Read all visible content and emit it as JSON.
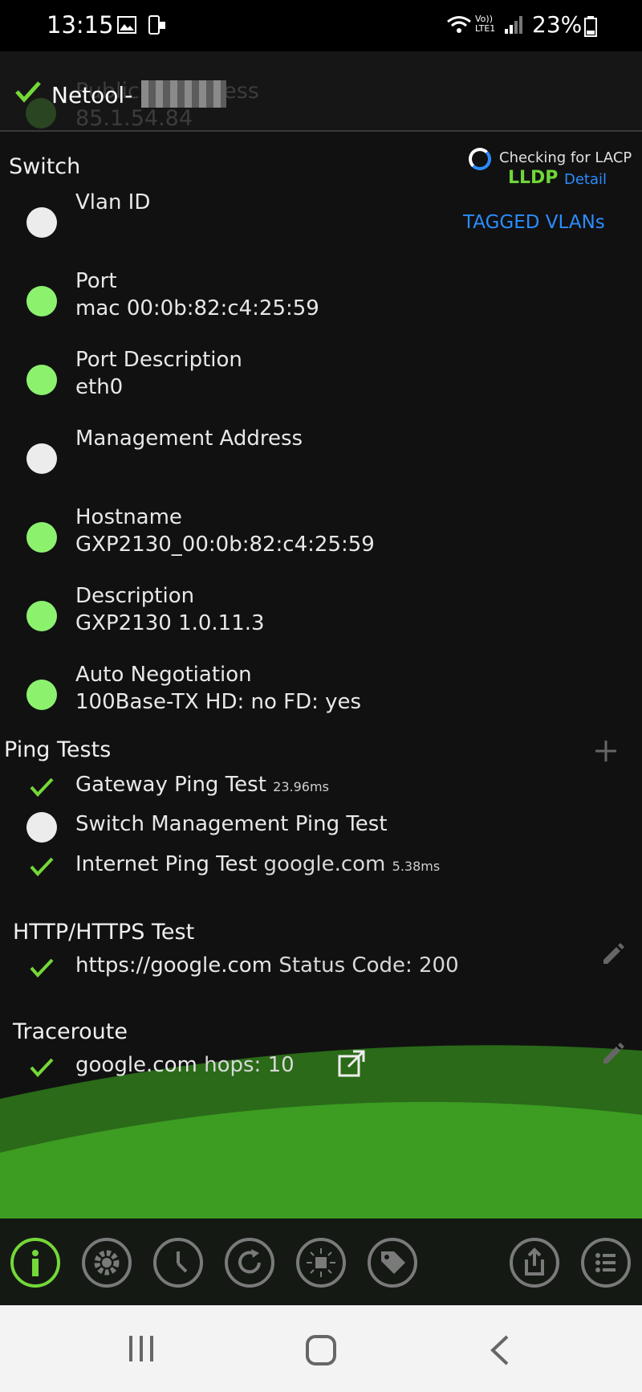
{
  "status_bar": {
    "time": "13:15",
    "battery": "23%",
    "network": "Vo)) LTE1"
  },
  "header": {
    "app_name": "Netool-",
    "faded_label": "Public IP Address",
    "faded_value": "85.1.54.84"
  },
  "switch": {
    "title": "Switch",
    "lacp_status": "Checking for LACP",
    "protocol": "LLDP",
    "detail_link": "Detail",
    "tagged_vlans_button": "TAGGED VLANs",
    "items": [
      {
        "label": "Vlan ID",
        "value": ""
      },
      {
        "label": "Port",
        "value": "mac 00:0b:82:c4:25:59"
      },
      {
        "label": "Port Description",
        "value": "eth0"
      },
      {
        "label": "Management Address",
        "value": ""
      },
      {
        "label": "Hostname",
        "value": "GXP2130_00:0b:82:c4:25:59"
      },
      {
        "label": "Description",
        "value": "GXP2130 1.0.11.3"
      },
      {
        "label": "Auto Negotiation",
        "value": "100Base-TX HD: no FD: yes"
      }
    ]
  },
  "ping_tests": {
    "title": "Ping Tests",
    "items": [
      {
        "label": "Gateway Ping Test",
        "extra": "",
        "time": "23.96ms"
      },
      {
        "label": "Switch Management Ping Test",
        "extra": "",
        "time": ""
      },
      {
        "label": "Internet Ping Test",
        "extra": "google.com",
        "time": "5.38ms"
      }
    ]
  },
  "http_test": {
    "title": "HTTP/HTTPS Test",
    "url": "https://google.com",
    "status": "Status Code: 200"
  },
  "traceroute": {
    "title": "Traceroute",
    "host": "google.com",
    "hops": "hops: 10"
  },
  "colors": {
    "accent_green": "#74d838",
    "dot_green": "#8cf26e",
    "link_blue": "#2b8cff",
    "lldp_green": "#6fd63a"
  }
}
